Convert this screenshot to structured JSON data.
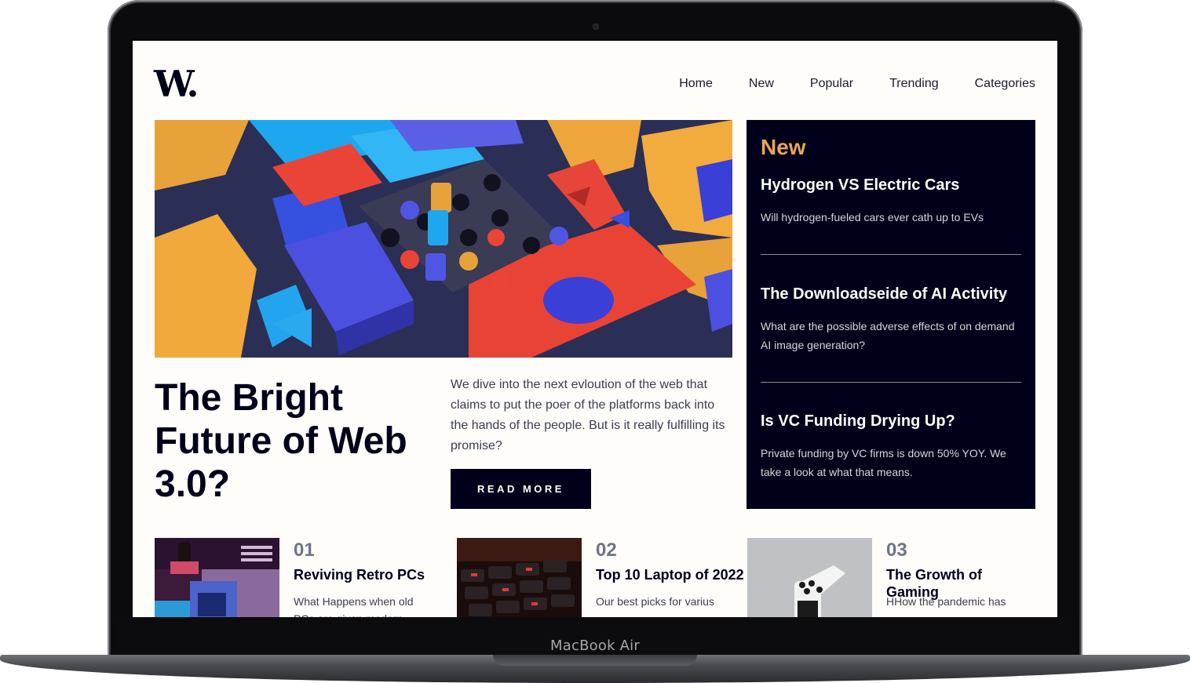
{
  "device": {
    "model_label": "MacBook Air"
  },
  "site": {
    "logo": "W.",
    "nav": [
      "Home",
      "New",
      "Popular",
      "Trending",
      "Categories"
    ]
  },
  "hero": {
    "headline": "The Bright Future of Web 3.0?",
    "lede": "We dive into the next evloution of the web that claims to put the poer of the platforms back into the hands of the people. But is it really fulfilling its promise?",
    "cta_label": "READ MORE"
  },
  "new_panel": {
    "heading": "New",
    "items": [
      {
        "title": "Hydrogen VS Electric Cars",
        "summary": "Will hydrogen-fueled cars ever cath up to EVs"
      },
      {
        "title": "The Downloadseide of AI Activity",
        "summary": "What are the possible adverse effects of on demand AI image generation?"
      },
      {
        "title": "Is VC Funding Drying Up?",
        "summary": "Private funding by VC firms is down 50% YOY. We take a look at what that means."
      }
    ]
  },
  "articles": [
    {
      "number": "01",
      "title": "Reviving Retro PCs",
      "summary": "What Happens when old PCs are given modern"
    },
    {
      "number": "02",
      "title": "Top 10 Laptop of 2022",
      "summary": "Our best picks for varius"
    },
    {
      "number": "03",
      "title": "The Growth of Gaming",
      "summary": "HHow the pandemic has"
    }
  ],
  "colors": {
    "navy": "#00001a",
    "accent": "#e9a55a",
    "background": "#fffdfa"
  }
}
